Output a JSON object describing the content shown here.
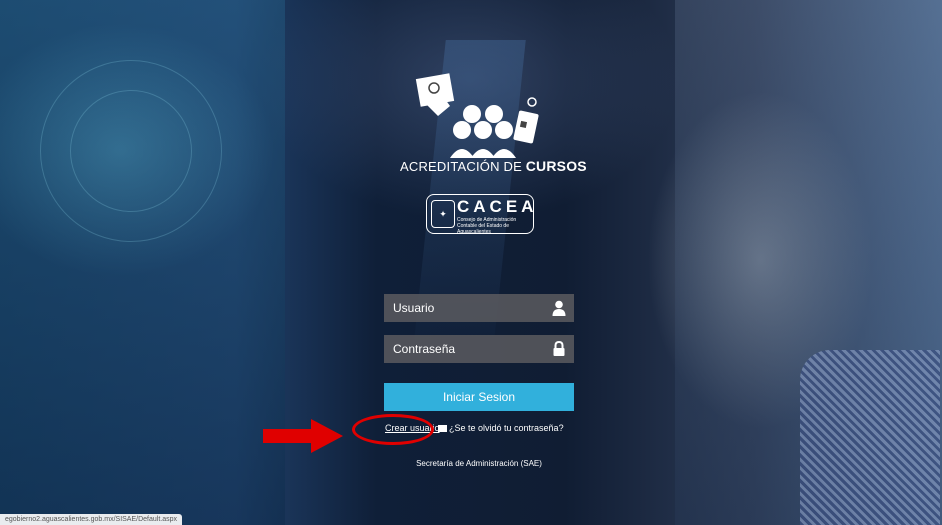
{
  "logo": {
    "title_prefix": "ACREDITACIÓN DE ",
    "title_bold": "CURSOS"
  },
  "org": {
    "name": "CACEA",
    "description": "Consejo de Administración Contable del Estado de Aguascalientes"
  },
  "form": {
    "username_placeholder": "Usuario",
    "password_placeholder": "Contraseña",
    "login_label": "Iniciar Sesion",
    "create_user_label": "Crear usuario",
    "forgot_password_label": "¿Se te olvidó tu contraseña?"
  },
  "footer": {
    "text": "Secretaría de Administración (SAE)"
  },
  "status": {
    "url": "egobierno2.aguascalientes.gob.mx/SISAE/Default.aspx"
  },
  "icons": {
    "user": "user-icon",
    "lock": "lock-icon",
    "mail": "envelope-icon",
    "arrow": "arrow-right-icon"
  },
  "colors": {
    "login_button": "#31b0dc",
    "annotation": "#e00000",
    "field_bg": "#5a5a5f"
  }
}
